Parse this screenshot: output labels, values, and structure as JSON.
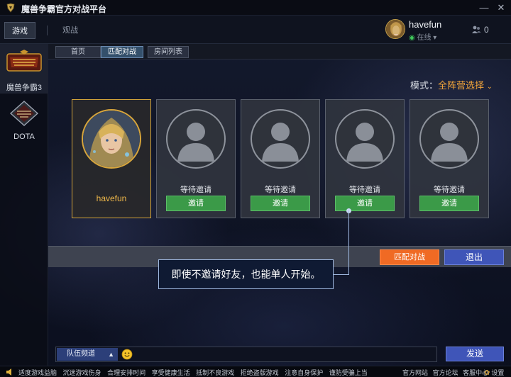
{
  "window": {
    "title": "魔兽争霸官方对战平台",
    "minimize_glyph": "—",
    "close_glyph": "✕"
  },
  "topnav": {
    "tabs": [
      {
        "label": "游戏",
        "active": true
      },
      {
        "label": "观战",
        "active": false
      }
    ]
  },
  "user": {
    "name": "havefun",
    "status": "在线",
    "status_caret": "▾",
    "friends_count": "0"
  },
  "sidebar": {
    "items": [
      {
        "label": "魔兽争霸3",
        "active": true
      },
      {
        "label": "DOTA",
        "active": false
      }
    ]
  },
  "subtabs": [
    {
      "label": "首页",
      "active": false
    },
    {
      "label": "匹配对战",
      "active": true
    },
    {
      "label": "房间列表",
      "active": false
    }
  ],
  "mode": {
    "label": "模式：",
    "value": "全阵营选择",
    "caret": "⌄"
  },
  "slots": {
    "host": {
      "name": "havefun"
    },
    "empty": [
      {
        "status": "等待邀请",
        "button": "邀请"
      },
      {
        "status": "等待邀请",
        "button": "邀请"
      },
      {
        "status": "等待邀请",
        "button": "邀请"
      },
      {
        "status": "等待邀请",
        "button": "邀请"
      }
    ]
  },
  "actions": {
    "match": "匹配对战",
    "exit": "退出"
  },
  "callout": {
    "text": "即使不邀请好友，也能单人开始。"
  },
  "chat": {
    "channel": "队伍频道",
    "caret": "▲",
    "send": "发送"
  },
  "bottombar": {
    "tips": [
      "适度游戏益脑",
      "沉迷游戏伤身",
      "合理安排时间",
      "享受健康生活",
      "抵制不良游戏",
      "拒绝盗版游戏",
      "注意自身保护",
      "谨防受骗上当"
    ],
    "links": [
      "官方网站",
      "官方论坛",
      "客服中心"
    ],
    "settings": "设置",
    "settings_glyph": "✿"
  },
  "colors": {
    "accent_orange": "#f06a24",
    "accent_blue": "#3f55b8",
    "invite_green": "#3b9a48",
    "host_gold": "#d4a43a",
    "mode_orange": "#f0a43a"
  }
}
